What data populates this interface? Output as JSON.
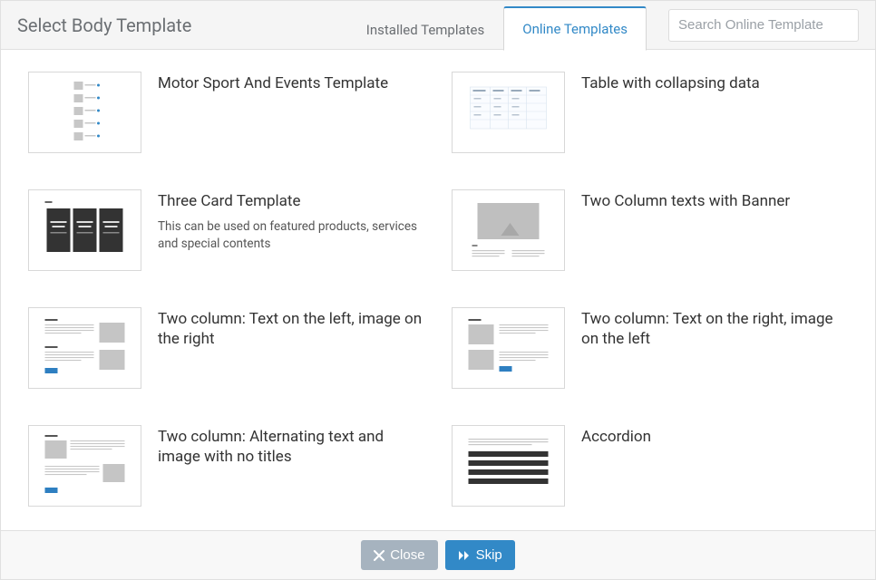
{
  "header": {
    "title": "Select Body Template",
    "tabs": {
      "installed": "Installed Templates",
      "online": "Online Templates",
      "active": "online"
    },
    "search": {
      "placeholder": "Search Online Template"
    }
  },
  "templates": [
    {
      "title": "Motor Sport And Events Template",
      "desc": ""
    },
    {
      "title": "Table with collapsing data",
      "desc": ""
    },
    {
      "title": "Three Card Template",
      "desc": "This can be used on featured products, services and special contents"
    },
    {
      "title": "Two Column texts with Banner",
      "desc": ""
    },
    {
      "title": "Two column: Text on the left, image on the right",
      "desc": ""
    },
    {
      "title": "Two column: Text on the right, image on the left",
      "desc": ""
    },
    {
      "title": "Two column: Alternating text and image with no titles",
      "desc": ""
    },
    {
      "title": "Accordion",
      "desc": ""
    }
  ],
  "footer": {
    "close_label": "Close",
    "skip_label": "Skip"
  }
}
